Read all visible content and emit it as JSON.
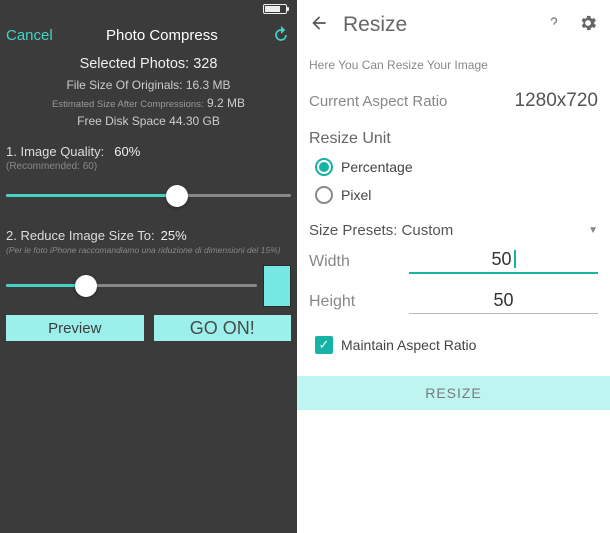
{
  "left": {
    "header": {
      "cancel": "Cancel",
      "title": "Photo Compress"
    },
    "stats": {
      "selected_label": "Selected Photos:",
      "selected_count": "328",
      "orig_label": "File Size Of Originals:",
      "orig_size": "16.3 MB",
      "est_label": "Estimated Size After Compressions:",
      "est_size": "9.2 MB",
      "free_label": "Free Disk Space",
      "free_val": "44.30 GB"
    },
    "quality": {
      "label": "1. Image Quality:",
      "value": "60%",
      "rec": "(Recommended: 60)",
      "fill_pct": 60
    },
    "reduce": {
      "label": "2. Reduce Image Size To:",
      "value": "25%",
      "note": "(Per le foto iPhone raccomandiamo una riduzione di dimensioni del 15%)",
      "fill_pct": 32
    },
    "buttons": {
      "preview": "Preview",
      "go": "GO ON!"
    }
  },
  "right": {
    "title": "Resize",
    "hint": "Here You Can Resize Your Image",
    "ratio_label": "Current Aspect Ratio",
    "ratio_value": "1280x720",
    "unit_label": "Resize Unit",
    "units": {
      "percentage": "Percentage",
      "pixel": "Pixel"
    },
    "presets_label": "Size Presets:",
    "presets_value": "Custom",
    "width_label": "Width",
    "width_value": "50",
    "height_label": "Height",
    "height_value": "50",
    "maintain": "Maintain Aspect Ratio",
    "resize_btn": "RESIZE"
  }
}
